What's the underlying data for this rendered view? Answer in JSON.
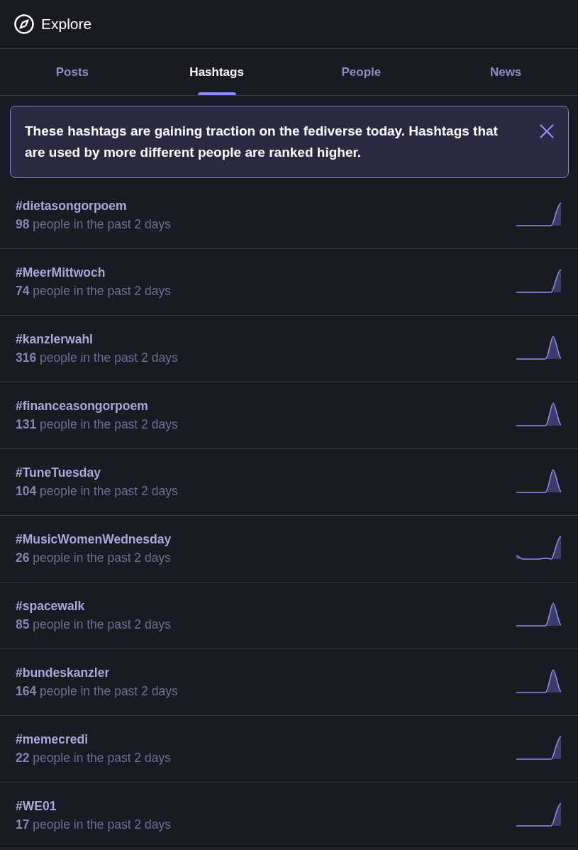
{
  "header": {
    "title": "Explore"
  },
  "tabs": [
    {
      "label": "Posts",
      "selected": false
    },
    {
      "label": "Hashtags",
      "selected": true
    },
    {
      "label": "People",
      "selected": false
    },
    {
      "label": "News",
      "selected": false
    }
  ],
  "notice": {
    "text": "These hashtags are gaining traction on the fediverse today. Hashtags that are used by more different people are ranked higher."
  },
  "hashtags": [
    {
      "tag": "#dietasongorpoem",
      "usage": "**98** people in the past 2 days",
      "kind": "spike"
    },
    {
      "tag": "#MeerMittwoch",
      "usage": "**74** people in the past 2 days",
      "kind": "spike"
    },
    {
      "tag": "#kanzlerwahl",
      "usage": "**316** people in the past 2 days",
      "kind": "peak"
    },
    {
      "tag": "#financeasongorpoem",
      "usage": "**131** people in the past 2 days",
      "kind": "peak"
    },
    {
      "tag": "#TuneTuesday",
      "usage": "**104** people in the past 2 days",
      "kind": "peak"
    },
    {
      "tag": "#MusicWomenWednesday",
      "usage": "**26** people in the past 2 days",
      "kind": "dip"
    },
    {
      "tag": "#spacewalk",
      "usage": "**85** people in the past 2 days",
      "kind": "peak"
    },
    {
      "tag": "#bundeskanzler",
      "usage": "**164** people in the past 2 days",
      "kind": "peak"
    },
    {
      "tag": "#memecredi",
      "usage": "**22** people in the past 2 days",
      "kind": "spike"
    },
    {
      "tag": "#WE01",
      "usage": "**17** people in the past 2 days",
      "kind": "spike"
    }
  ]
}
